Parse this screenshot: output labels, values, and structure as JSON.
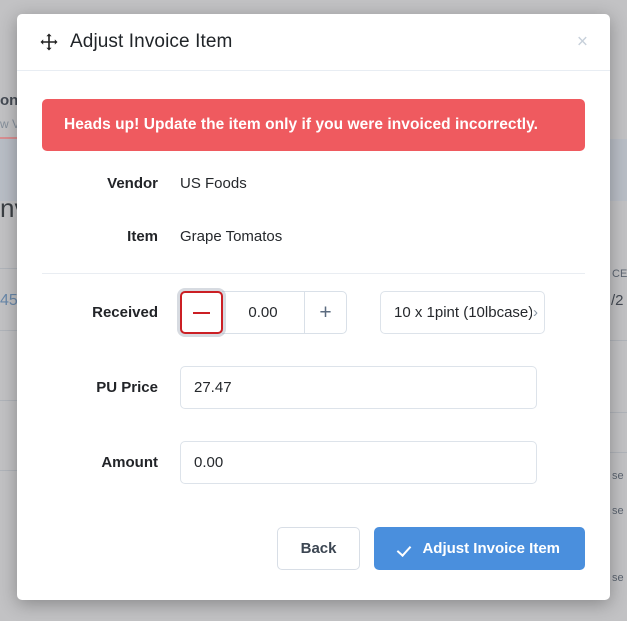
{
  "dialog": {
    "title": "Adjust Invoice Item",
    "move_icon": "move-cross-icon",
    "close_label": "×",
    "alert": {
      "text": "Heads up! Update the item only if you were invoiced incorrectly.",
      "color": "#ef5a5f"
    },
    "fields": {
      "vendor_label": "Vendor",
      "vendor_value": "US Foods",
      "item_label": "Item",
      "item_value": "Grape Tomatos",
      "received_label": "Received",
      "received_value": "0.00",
      "decrement_label": "—",
      "increment_label": "+",
      "unit_value": "10 x 1pint (10lbcase)",
      "unit_chevron": "›",
      "pu_price_label": "PU Price",
      "pu_price_value": "27.47",
      "amount_label": "Amount",
      "amount_value": "0.00"
    },
    "footer": {
      "back_label": "Back",
      "submit_label": "Adjust Invoice Item",
      "submit_icon": "check-icon",
      "submit_color": "#4a8fdd"
    }
  },
  "background": {
    "frag_top_bold": "on",
    "frag_top_muted": "w V",
    "frag_big_left": "nv",
    "frag_num_left": "45",
    "frag_right_ce": "CE",
    "frag_right_date": "/2",
    "frag_right_se1": "se",
    "frag_right_se2": "se",
    "frag_right_se3": "se"
  }
}
